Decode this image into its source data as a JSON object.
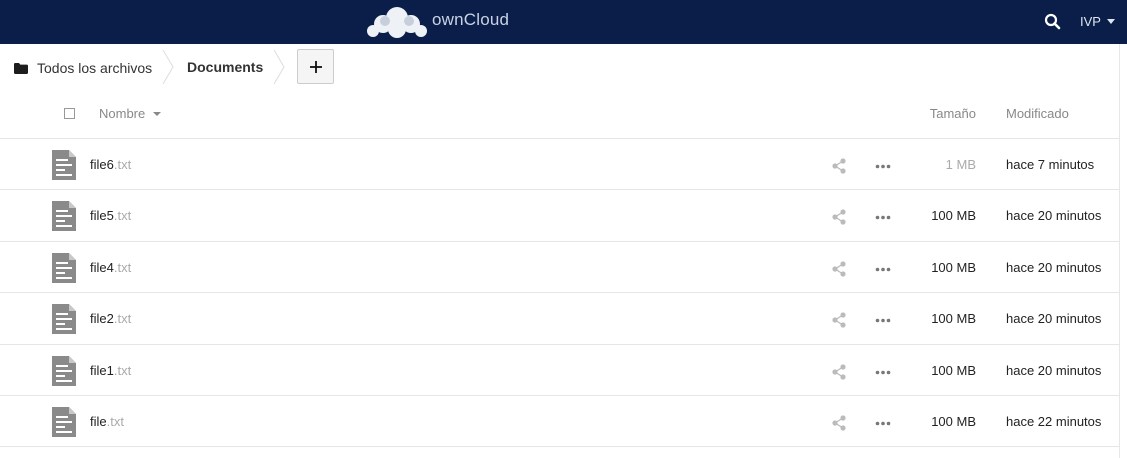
{
  "header": {
    "brand": "ownCloud",
    "user": "IVP",
    "icons": {
      "logo": "owncloud-cloud-logo",
      "search": "search-icon",
      "user_caret": "caret-down-icon"
    },
    "colors": {
      "background": "#0b1e4a"
    }
  },
  "breadcrumb": {
    "home": "Todos los archivos",
    "current": "Documents",
    "add_label": "+"
  },
  "table": {
    "headers": {
      "name": "Nombre",
      "size": "Tamaño",
      "modified": "Modificado"
    },
    "rows": [
      {
        "name": "file6",
        "ext": ".txt",
        "size": "1 MB",
        "modified": "hace 7 minutos"
      },
      {
        "name": "file5",
        "ext": ".txt",
        "size": "100 MB",
        "modified": "hace 20 minutos"
      },
      {
        "name": "file4",
        "ext": ".txt",
        "size": "100 MB",
        "modified": "hace 20 minutos"
      },
      {
        "name": "file2",
        "ext": ".txt",
        "size": "100 MB",
        "modified": "hace 20 minutos"
      },
      {
        "name": "file1",
        "ext": ".txt",
        "size": "100 MB",
        "modified": "hace 20 minutos"
      },
      {
        "name": "file",
        "ext": ".txt",
        "size": "100 MB",
        "modified": "hace 22 minutos"
      }
    ]
  }
}
